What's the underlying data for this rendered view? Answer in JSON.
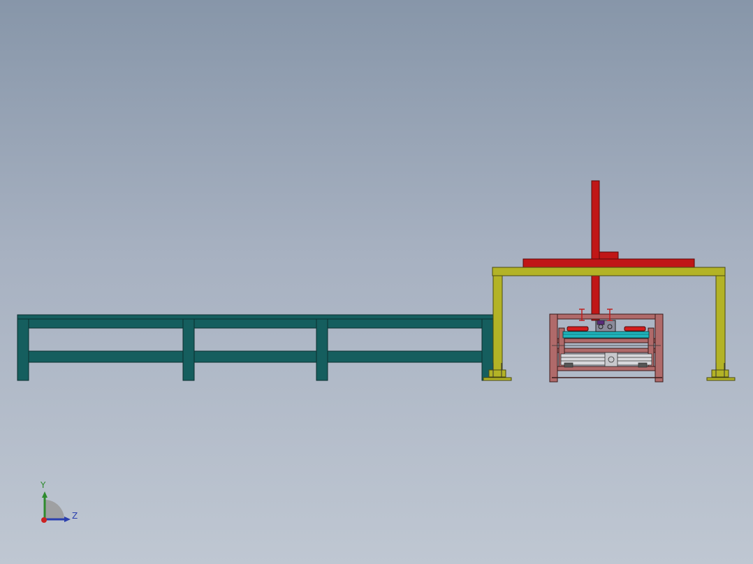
{
  "viewport": {
    "background_top": "#8796a9",
    "background_bottom": "#bfc7d2"
  },
  "colors": {
    "conveyor": "#155e5e",
    "gantry": "#b3b326",
    "arm": "#c01717",
    "frame": "#b06a6a",
    "cyan_roller": "#1fb5bd",
    "red_cylinder": "#d41c1c",
    "gripper_block": "#5a2a7a",
    "outline": "#1a1a1a"
  },
  "triad": {
    "y_label": "Y",
    "z_label": "Z",
    "y_color": "#2e8b2e",
    "z_color": "#2b3fae",
    "x_color": "#cc2222"
  }
}
